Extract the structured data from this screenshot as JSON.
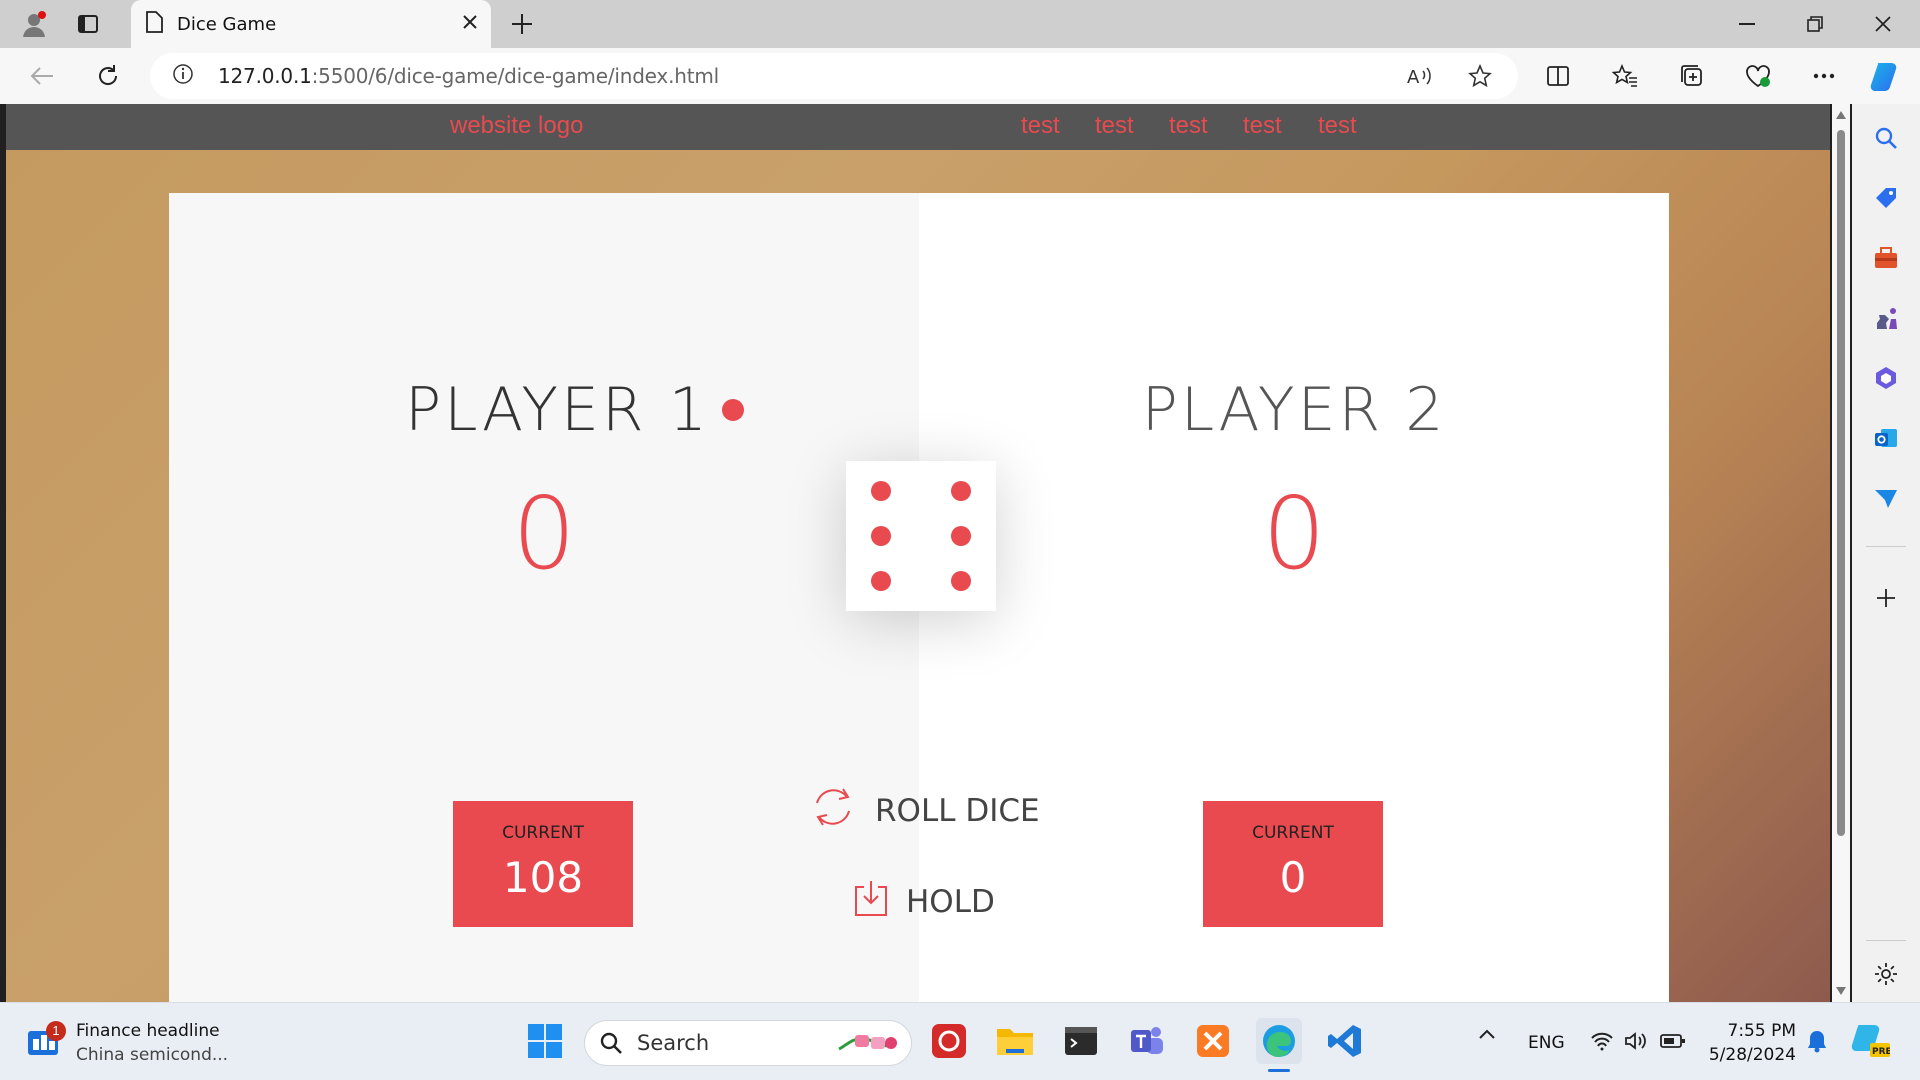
{
  "browser": {
    "tab_title": "Dice Game",
    "url_host": "127.0.0.1",
    "url_rest": ":5500/6/dice-game/dice-game/index.html"
  },
  "site": {
    "logo": "website logo",
    "nav": [
      "test",
      "test",
      "test",
      "test",
      "test"
    ]
  },
  "game": {
    "player1": {
      "name": "PLAYER 1",
      "score": "0",
      "current_label": "CURRENT",
      "current": "108",
      "active": true
    },
    "player2": {
      "name": "PLAYER 2",
      "score": "0",
      "current_label": "CURRENT",
      "current": "0",
      "active": false
    },
    "dice_value": 6,
    "roll_label": "ROLL DICE",
    "hold_label": "HOLD"
  },
  "taskbar": {
    "news_title": "Finance headline",
    "news_sub": "China semicond...",
    "news_badge": "1",
    "search_placeholder": "Search",
    "lang": "ENG",
    "time": "7:55 PM",
    "date": "5/28/2024"
  },
  "colors": {
    "accent": "#e84a4f",
    "header": "#555555"
  }
}
